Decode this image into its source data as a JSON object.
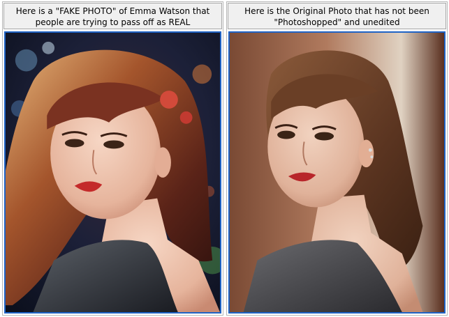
{
  "panels": [
    {
      "caption": "Here is a \"FAKE PHOTO\" of Emma Watson that people are trying to pass off as REAL",
      "image_alt": "Painted, digitally altered portrait of a woman with wavy reddish-brown hair, red lipstick and a dark sleeveless top, colorful bokeh background with rose hair accessories"
    },
    {
      "caption": "Here is the Original Photo that has not been \"Photoshopped\" and unedited",
      "image_alt": "Unedited photograph of a woman with brown hair swept to one side, red lipstick, ear cuffs and a dark grey sleeveless top against a brown backdrop"
    }
  ],
  "colors": {
    "frame_border": "#1e63c6",
    "caption_bg": "#f0f0f0"
  }
}
